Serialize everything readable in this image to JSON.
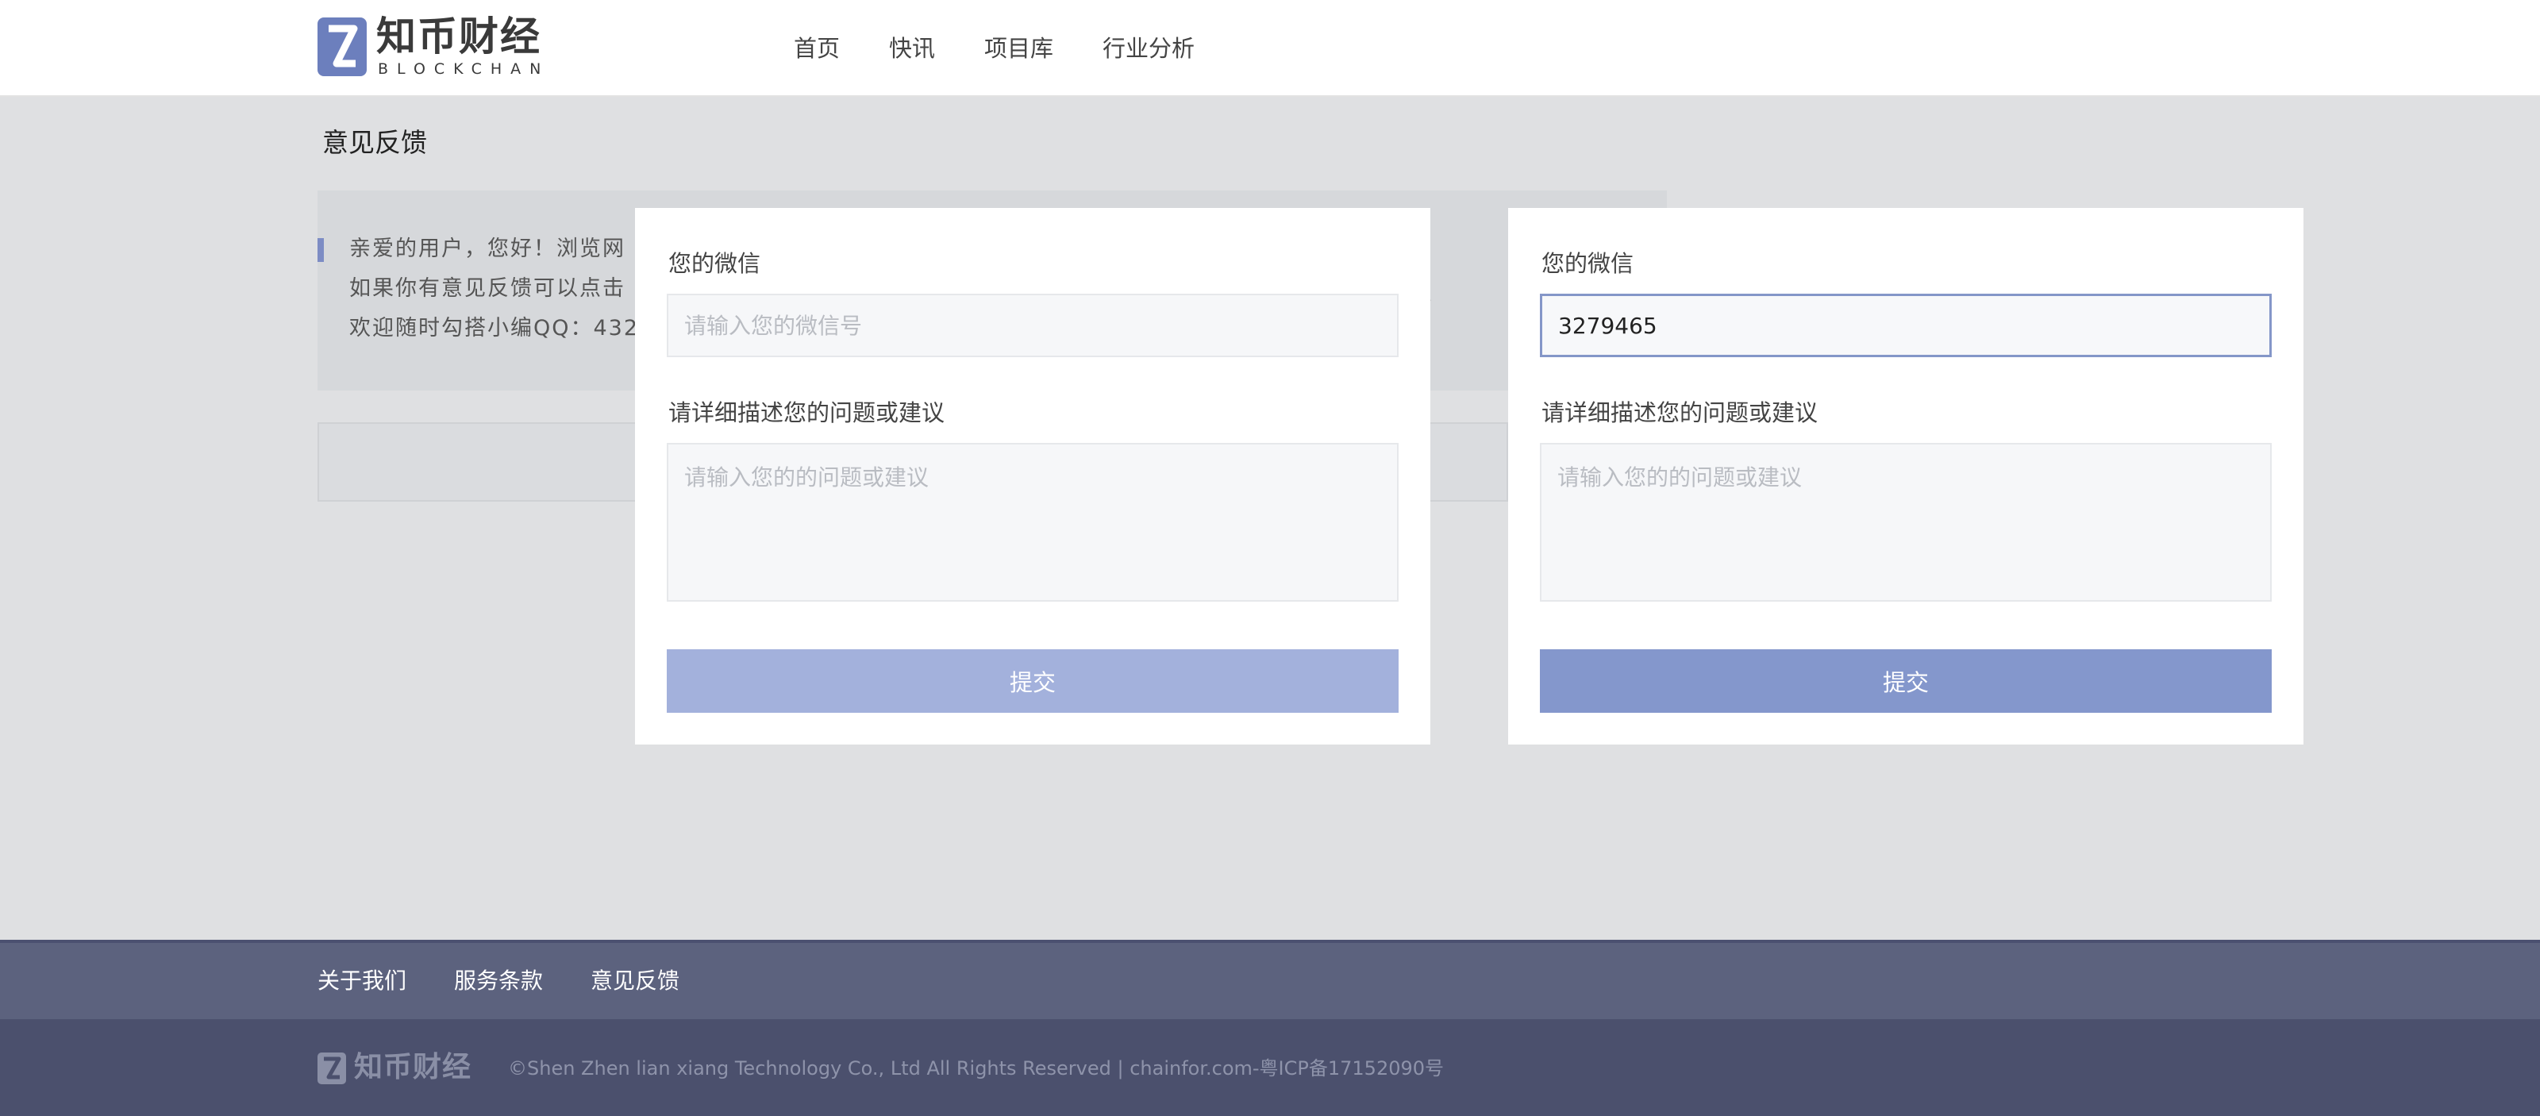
{
  "header": {
    "logo": {
      "title": "知币财经",
      "subtitle": "BLOCKCHAN"
    },
    "nav": [
      "首页",
      "快讯",
      "项目库",
      "行业分析"
    ]
  },
  "page": {
    "title": "意见反馈",
    "notice_lines": [
      "亲爱的用户，您好！浏览网",
      "如果你有意见反馈可以点击",
      "欢迎随时勾搭小编QQ：432"
    ],
    "notice_trailing_mark": "。"
  },
  "forms": [
    {
      "wechat_label": "您的微信",
      "wechat_placeholder": "请输入您的微信号",
      "wechat_value": "",
      "desc_label": "请详细描述您的问题或建议",
      "desc_placeholder": "请输入您的的问题或建议",
      "submit_label": "提交",
      "submit_state": "disabled"
    },
    {
      "wechat_label": "您的微信",
      "wechat_placeholder": "请输入您的微信号",
      "wechat_value": "3279465",
      "desc_label": "请详细描述您的问题或建议",
      "desc_placeholder": "请输入您的的问题或建议",
      "submit_label": "提交",
      "submit_state": "active"
    }
  ],
  "footer": {
    "links": [
      "关于我们",
      "服务条款",
      "意见反馈"
    ],
    "logo_text": "知币财经",
    "copyright": "©Shen Zhen lian xiang Technology Co., Ltd All Rights Reserved | chainfor.com-粤ICP备17152090号"
  },
  "colors": {
    "accent": "#8497cc",
    "accent_disabled": "#a3b1dc",
    "logo": "#6c7fbd",
    "footer_top": "#5c627e",
    "footer_bottom": "#4b506d"
  }
}
